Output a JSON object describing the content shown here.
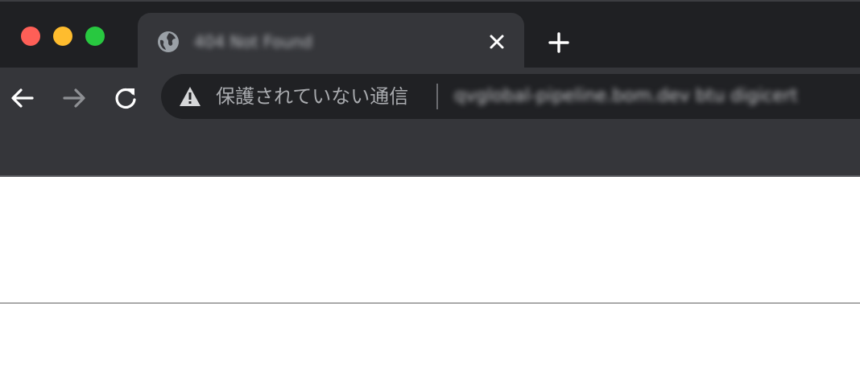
{
  "window": {
    "traffic_lights": {
      "close_color": "#fe5f57",
      "minimize_color": "#febc2e",
      "maximize_color": "#28c840"
    }
  },
  "tab": {
    "icon": "globe-icon",
    "title": "404 Not Found",
    "close_icon": "close-icon"
  },
  "new_tab": {
    "icon": "plus-icon"
  },
  "toolbar": {
    "back_icon": "arrow-left-icon",
    "forward_icon": "arrow-right-icon",
    "reload_icon": "reload-icon"
  },
  "omnibox": {
    "security_icon": "warning-triangle-icon",
    "security_label": "保護されていない通信",
    "url": "qvglobal-pipeline.bom.dev btu digicert"
  },
  "colors": {
    "tabstrip_bg": "#1f2023",
    "toolbar_bg": "#35363a",
    "omnibox_bg": "#202124"
  }
}
